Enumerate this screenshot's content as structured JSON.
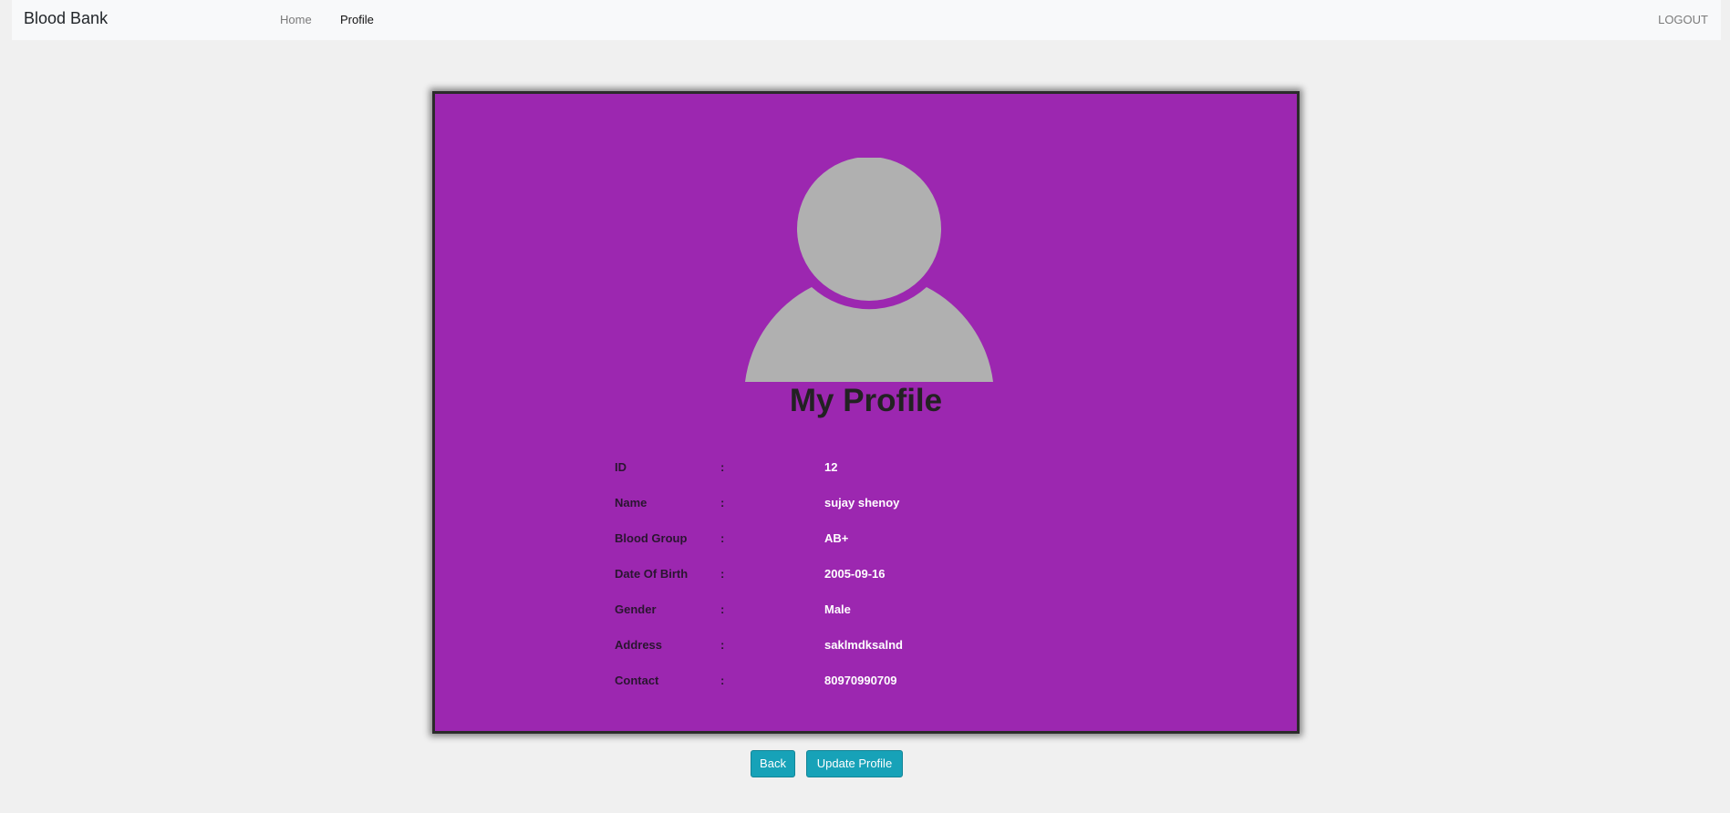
{
  "navbar": {
    "brand": "Blood Bank",
    "links": [
      "Home",
      "Profile"
    ],
    "logout": "LOGOUT"
  },
  "profile": {
    "avatar_icon": "user-avatar-icon",
    "title": "My Profile",
    "separator": ":",
    "fields": [
      {
        "label": "ID",
        "value": "12"
      },
      {
        "label": "Name",
        "value": "sujay shenoy"
      },
      {
        "label": "Blood Group",
        "value": "AB+"
      },
      {
        "label": "Date Of Birth",
        "value": "2005-09-16"
      },
      {
        "label": "Gender",
        "value": "Male"
      },
      {
        "label": "Address",
        "value": "saklmdksalnd"
      },
      {
        "label": "Contact",
        "value": "80970990709"
      }
    ]
  },
  "actions": {
    "back_label": "Back",
    "update_label": "Update Profile"
  },
  "colors": {
    "card_background": "#9c27b0",
    "avatar": "#b0b0b0",
    "button": "#17a2b8"
  }
}
